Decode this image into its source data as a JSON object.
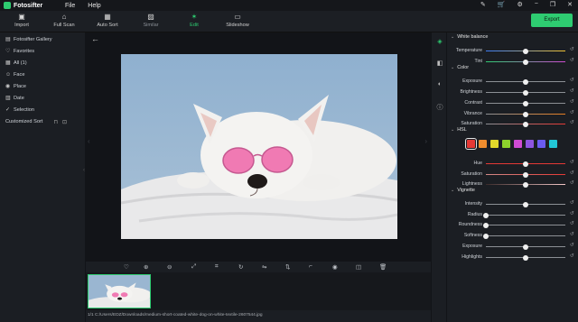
{
  "app": {
    "name": "Fotosifter"
  },
  "menu": [
    "File",
    "Help"
  ],
  "title_icons": [
    "magic-wand-icon",
    "cart-icon",
    "gear-icon",
    "minimize-icon",
    "restore-icon",
    "close-icon"
  ],
  "toolbar": {
    "tools": [
      {
        "label": "Import",
        "icon": "import-icon"
      },
      {
        "label": "Full Scan",
        "icon": "scan-icon"
      },
      {
        "label": "Auto Sort",
        "icon": "auto-sort-icon"
      },
      {
        "label": "Similar",
        "icon": "similar-icon"
      },
      {
        "label": "Edit",
        "icon": "edit-icon"
      },
      {
        "label": "Slideshow",
        "icon": "slideshow-icon"
      }
    ],
    "export_label": "Export"
  },
  "sidebar": {
    "items": [
      {
        "label": "Fotosifter Gallery",
        "icon": "gallery-icon"
      },
      {
        "label": "Favorites",
        "icon": "heart-icon"
      },
      {
        "label": "All (1)",
        "icon": "grid-icon"
      },
      {
        "label": "Face",
        "icon": "face-icon"
      },
      {
        "label": "Place",
        "icon": "pin-icon"
      },
      {
        "label": "Date",
        "icon": "calendar-icon"
      },
      {
        "label": "Selection",
        "icon": "thumb-icon"
      }
    ],
    "customized_sort": "Customized Sort"
  },
  "bottom_tools": [
    "heart-icon",
    "zoom-in-icon",
    "zoom-out-icon",
    "fit-icon",
    "crop-area-icon",
    "rotate-icon",
    "flip-horizontal-icon",
    "flip-vertical-icon",
    "crop-icon",
    "eye-icon",
    "compare-icon",
    "delete-icon"
  ],
  "statusbar": {
    "text": "1/1  C:/Users/EDZ/Downloads/medium-short-coated-white-dog-on-white-textile-2607544.jpg"
  },
  "panel": {
    "white_balance": {
      "title": "White balance",
      "sliders": [
        {
          "label": "Temperature",
          "value": 0.5
        },
        {
          "label": "Tint",
          "value": 0.5
        }
      ]
    },
    "color": {
      "title": "Color",
      "sliders": [
        {
          "label": "Exposure",
          "value": 0.5
        },
        {
          "label": "Brightness",
          "value": 0.5
        },
        {
          "label": "Contrast",
          "value": 0.5
        },
        {
          "label": "Vibrance",
          "value": 0.5
        },
        {
          "label": "Saturation",
          "value": 0.5
        }
      ]
    },
    "hsl": {
      "title": "HSL",
      "swatches": [
        "#e53935",
        "#ef8c2e",
        "#e3d92b",
        "#8dd12c",
        "#d04bd3",
        "#8f55e0",
        "#6a5cf0",
        "#22c7d6"
      ],
      "selected_swatch": 0,
      "sliders": [
        {
          "label": "Hue",
          "value": 0.5
        },
        {
          "label": "Saturation",
          "value": 0.5
        },
        {
          "label": "Lightness",
          "value": 0.5
        }
      ]
    },
    "vignette": {
      "title": "Vignette",
      "sliders": [
        {
          "label": "Intensity",
          "value": 0.5
        },
        {
          "label": "Radius",
          "value": 0.0
        },
        {
          "label": "Roundness",
          "value": 0.0
        },
        {
          "label": "Softness",
          "value": 0.0
        },
        {
          "label": "Exposure",
          "value": 0.5
        },
        {
          "label": "Highlights",
          "value": 0.5
        }
      ]
    }
  },
  "colors": {
    "accent": "#2ecc71",
    "background": "#1b1e23"
  }
}
